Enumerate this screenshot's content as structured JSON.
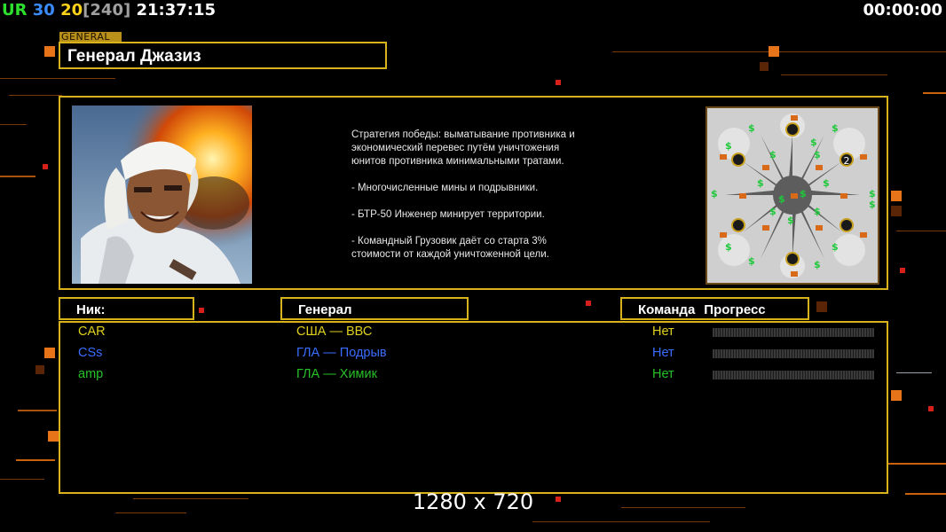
{
  "overlay": {
    "ur": "UR",
    "val1": "30",
    "val2": "20",
    "val3": "[240]",
    "clock": "21:37:15",
    "timer": "00:00:00",
    "colors": {
      "ur": "#2ee02e",
      "val1": "#3a8cff",
      "val2": "#ffd21a",
      "val3": "#a0a0a0",
      "clock": "#ffffff"
    }
  },
  "general": {
    "tag": "GENERAL",
    "name": "Генерал Джазиз"
  },
  "description": {
    "strategy": "Стратегия победы: выматывание противника и\n экономический перевес путём уничтожения\n юнитов противника минимальными тратами.",
    "point1": "- Многочисленные мины и подрывники.",
    "point2": "- БТР-50 Инженер минирует территории.",
    "point3": "- Командный Грузовик даёт со старта 3%\n стоимости от каждой уничтоженной цели."
  },
  "minimap": {
    "player_marker": "2"
  },
  "headers": {
    "nick": "Ник:",
    "general": "Генерал",
    "team": "Команда",
    "progress": "Прогресс"
  },
  "players": [
    {
      "nick": "CAR",
      "general": "США — ВВС",
      "team": "Нет",
      "color": "#e0d020",
      "progress": 0
    },
    {
      "nick": "CSs",
      "general": "ГЛА — Подрыв",
      "team": "Нет",
      "color": "#3a6cff",
      "progress": 0
    },
    {
      "nick": "amp",
      "general": "ГЛА — Химик",
      "team": "Нет",
      "color": "#28c028",
      "progress": 0
    }
  ],
  "resolution": "1280 x 720",
  "accent": "#d8b21a"
}
